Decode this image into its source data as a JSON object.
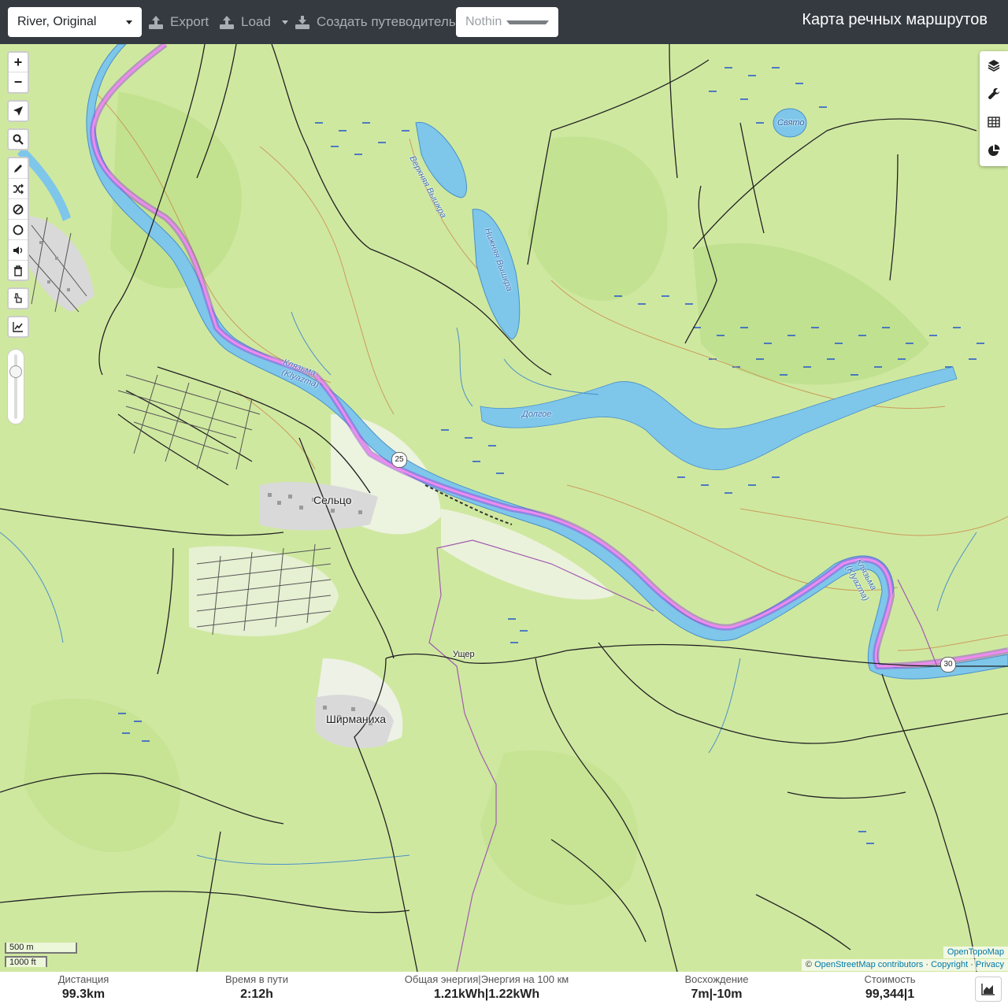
{
  "app_title": "Карта речных маршрутов",
  "toolbar": {
    "profile_value": "River, Original",
    "export_label": "Export",
    "load_label": "Load",
    "guide_label": "Создать путеводитель",
    "selection_value": "Nothing selected"
  },
  "map": {
    "places": [
      {
        "name": "Сельцо",
        "kind": "village"
      },
      {
        "name": "Ширманиха",
        "kind": "village"
      },
      {
        "name": "Ущер",
        "kind": "hamlet"
      }
    ],
    "water_labels": [
      {
        "name": "Верхняя Вышкра"
      },
      {
        "name": "Нижняя Вышкра"
      },
      {
        "name": "Клязьма"
      },
      {
        "name": "(Klyazma)"
      },
      {
        "name": "Клязьма"
      },
      {
        "name": "(Klyazma)"
      },
      {
        "name": "Долгое"
      },
      {
        "name": "Свято"
      }
    ],
    "route_shields": [
      "25",
      "30"
    ],
    "scale_metric": "500 m",
    "scale_imperial": "1000 ft",
    "attribution_top": "OpenTopoMap",
    "attribution_prefix": "©",
    "attribution_osm": "OpenStreetMap contributors",
    "attribution_sep1": "·",
    "attribution_copyright": "Copyright",
    "attribution_sep2": "·",
    "attribution_privacy": "Privacy",
    "colors": {
      "land": "#cfe8a0",
      "forest": "#bfe08a",
      "water": "#7ec6ea",
      "route": "#e04ee0",
      "roads": "#222222"
    }
  },
  "left_controls": {
    "zoom_in": "+",
    "zoom_out": "−",
    "icons": [
      "locate-icon",
      "search-icon",
      "draw-icon",
      "shuffle-icon",
      "no-entry-icon",
      "circle-icon",
      "sound-icon",
      "trash-icon",
      "pointer-icon",
      "elevation-chart-icon"
    ]
  },
  "right_controls": {
    "icons": [
      "layers-icon",
      "wrench-icon",
      "table-icon",
      "pie-chart-icon"
    ]
  },
  "stats": {
    "distance": {
      "label": "Дистанция",
      "value": "99.3",
      "unit": "km"
    },
    "time": {
      "label": "Время в пути",
      "value": "2:12",
      "unit": "h"
    },
    "energy": {
      "label": "Общая энергия|Энергия на 100 км",
      "value": "1.21",
      "unit": "kWh",
      "value2": "1.22",
      "unit2": "kWh",
      "sep": "|"
    },
    "ascent": {
      "label": "Восхождение",
      "value": "7",
      "unit": "m",
      "value2": "-10",
      "unit2": "m",
      "sep": "|"
    },
    "cost": {
      "label": "Стоимость",
      "value": "99,344",
      "value2": "1",
      "sep": "|"
    }
  }
}
